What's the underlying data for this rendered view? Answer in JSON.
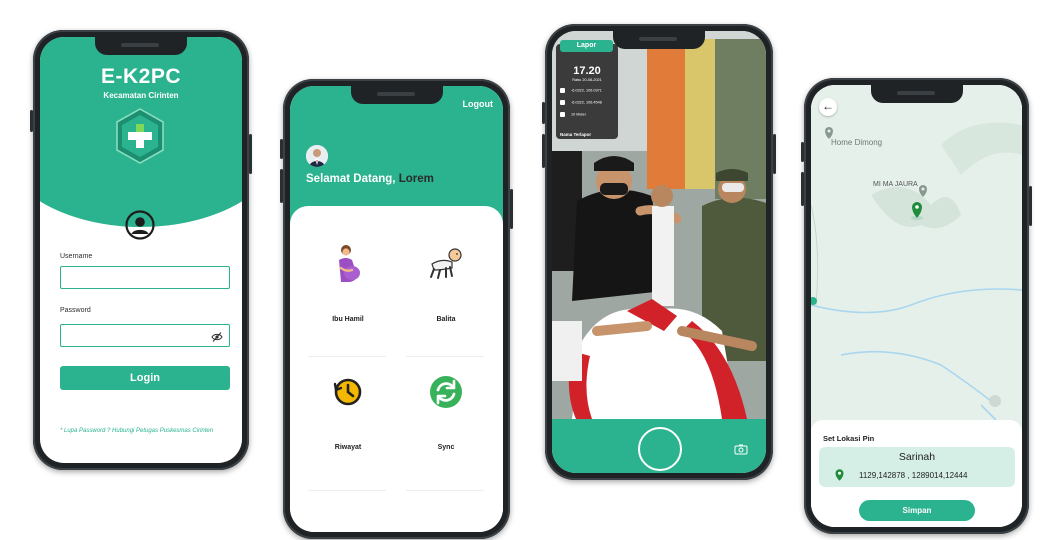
{
  "colors": {
    "accent": "#2ab38e",
    "accent_dark": "#1b8f70",
    "panel_light": "#d6efe6",
    "text_dark": "#222222"
  },
  "login_screen": {
    "app_title": "E-K2PC",
    "subtitle": "Kecamatan Cirinten",
    "logo_icon": "green-cross-hexagon-icon",
    "avatar_icon": "user-circle-icon",
    "username_label": "Username",
    "username_value": "",
    "password_label": "Password",
    "password_value": "",
    "eye_icon": "eye-slash-icon",
    "login_button": "Login",
    "forgot_text": "* Lupa Password ? Hubungi Petugas Puskesmas Cirinten"
  },
  "home_screen": {
    "logout": "Logout",
    "welcome_prefix": "Selamat Datang,",
    "welcome_name": "Lorem",
    "menu": [
      {
        "label": "Ibu Hamil",
        "icon": "pregnant-woman-icon"
      },
      {
        "label": "Balita",
        "icon": "crawling-baby-icon"
      },
      {
        "label": "Riwayat",
        "icon": "history-clock-icon"
      },
      {
        "label": "Sync",
        "icon": "sync-icon"
      }
    ]
  },
  "camera_screen": {
    "tab": "Lapor",
    "time": "17.20",
    "date": "Rabu 20-08-2021",
    "rows": [
      "-6.0322, 106.0371",
      "-6.0322, 106.4548",
      "10 Meter"
    ],
    "name_label": "Nama Terlapor",
    "shutter_icon": "shutter-button-icon",
    "switch_icon": "switch-camera-icon"
  },
  "map_screen": {
    "back_icon": "arrow-left-icon",
    "poi_1": "Home Dimong",
    "poi_2": "MI MA JAURA",
    "panel_title": "Set Lokasi Pin",
    "location_name": "Sarinah",
    "coordinates": "1129,142878 , 1289014,12444",
    "save_button": "Simpan"
  }
}
